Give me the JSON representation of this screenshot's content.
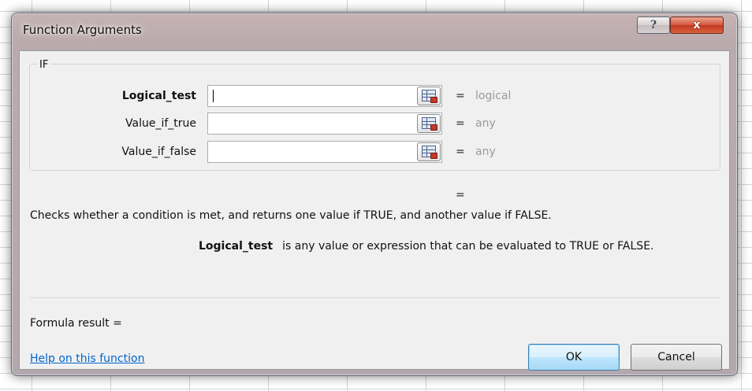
{
  "window": {
    "title": "Function Arguments",
    "help_glyph": "?",
    "close_glyph": "x"
  },
  "function_group": {
    "name": "IF",
    "arguments": [
      {
        "label": "Logical_test",
        "value": "",
        "result_hint": "logical"
      },
      {
        "label": "Value_if_true",
        "value": "",
        "result_hint": "any"
      },
      {
        "label": "Value_if_false",
        "value": "",
        "result_hint": "any"
      }
    ],
    "equals": "="
  },
  "description": "Checks whether a condition is met, and returns one value if TRUE, and another value if FALSE.",
  "argument_help": {
    "name": "Logical_test",
    "text": "is any value or expression that can be evaluated to TRUE or FALSE."
  },
  "formula_result_label": "Formula result =",
  "help_link": "Help on this function",
  "buttons": {
    "ok": "OK",
    "cancel": "Cancel"
  },
  "colors": {
    "hint_gray": "#9a9a9a",
    "link_blue": "#0066cc",
    "close_red": "#c13a22"
  }
}
